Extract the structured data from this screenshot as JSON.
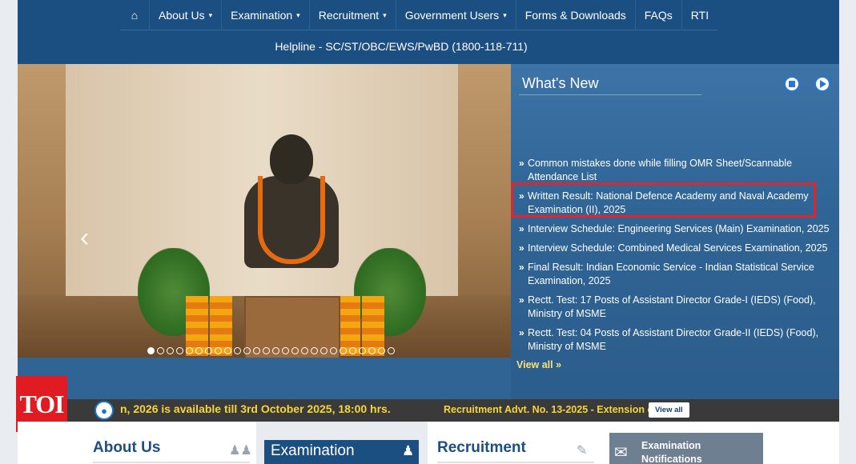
{
  "nav": {
    "home_icon": "⌂",
    "items": [
      {
        "label": "About Us",
        "caret": true
      },
      {
        "label": "Examination",
        "caret": true
      },
      {
        "label": "Recruitment",
        "caret": true
      },
      {
        "label": "Government Users",
        "caret": true
      },
      {
        "label": "Forms & Downloads",
        "caret": false
      },
      {
        "label": "FAQs",
        "caret": false
      },
      {
        "label": "RTI",
        "caret": false
      }
    ]
  },
  "helpline": "Helpline - SC/ST/OBC/EWS/PwBD (1800-118-711)",
  "slider": {
    "prev_glyph": "‹",
    "dot_count": 26,
    "active_dot": 0
  },
  "whats_new": {
    "title": "What's New",
    "items": [
      {
        "text": "Common mistakes done while filling OMR Sheet/Scannable Attendance List",
        "highlight": false
      },
      {
        "text": "Written Result: National Defence Academy and Naval Academy Examination (II), 2025",
        "highlight": true
      },
      {
        "text": "Interview Schedule: Engineering Services (Main) Examination, 2025",
        "highlight": false
      },
      {
        "text": "Interview Schedule: Combined Medical Services Examination, 2025",
        "highlight": false
      },
      {
        "text": "Final Result: Indian Economic Service - Indian Statistical Service Examination, 2025",
        "highlight": false
      },
      {
        "text": "Rectt. Test: 17 Posts of Assistant Director Grade-I (IEDS) (Food), Ministry of MSME",
        "highlight": false
      },
      {
        "text": "Rectt. Test: 04 Posts of Assistant Director Grade-II (IEDS) (Food), Ministry of MSME",
        "highlight": false
      }
    ],
    "view_all": "View all »"
  },
  "ticker": {
    "text1": "n, 2026 is available till 3rd October 2025, 18:00 hrs.",
    "text2": "Recruitment Advt. No. 13-2025 - Extension o",
    "view_all": "View all"
  },
  "toi_logo": "TOI",
  "sections": {
    "about": "About Us",
    "examination": "Examination",
    "recruitment": "Recruitment",
    "notifications": "Examination Notifications"
  },
  "colors": {
    "nav_bg": "#1b4f82",
    "news_bg": "#2f6495",
    "highlight_border": "#e3242b",
    "ticker_text": "#f5d63b",
    "toi_red": "#e11b22"
  }
}
